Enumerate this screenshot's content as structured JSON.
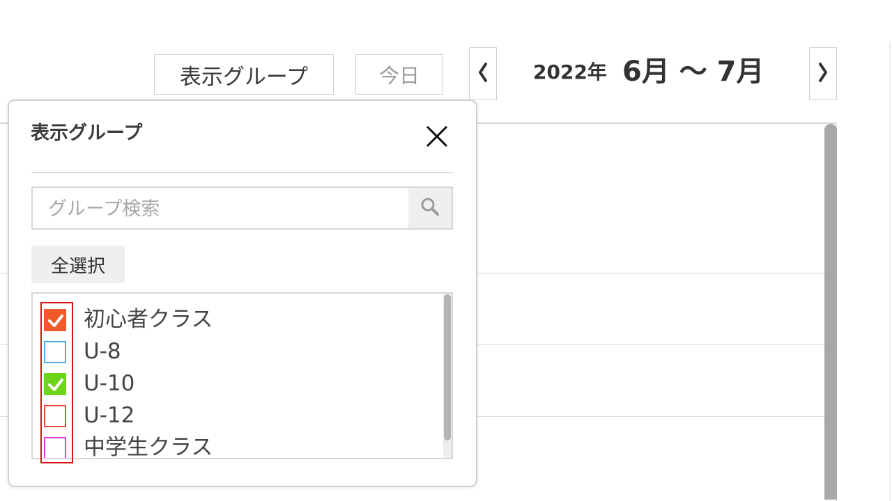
{
  "toolbar": {
    "display_group_label": "表示グループ",
    "today_label": "今日",
    "year_label": "2022年",
    "range_label": "6月 ～ 7月",
    "prev_icon": "chevron-left-icon",
    "next_icon": "chevron-right-icon"
  },
  "popup": {
    "title": "表示グループ",
    "close_icon": "close-icon",
    "search": {
      "placeholder": "グループ検索",
      "value": "",
      "icon": "search-icon"
    },
    "select_all_label": "全選択",
    "groups": [
      {
        "label": "初心者クラス",
        "checked": true,
        "color": "#ef5a28"
      },
      {
        "label": "U-8",
        "checked": false,
        "color": "#4aa7e6"
      },
      {
        "label": "U-10",
        "checked": true,
        "color": "#6fd41a"
      },
      {
        "label": "U-12",
        "checked": false,
        "color": "#ec4b3c"
      },
      {
        "label": "中学生クラス",
        "checked": false,
        "color": "#e63ad8"
      }
    ]
  },
  "colors": {
    "highlight": "#d41414",
    "check_mark": "#ffffff"
  }
}
